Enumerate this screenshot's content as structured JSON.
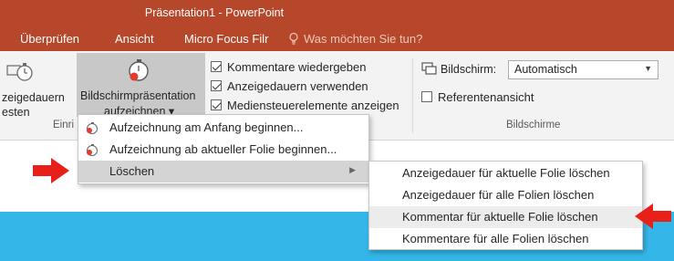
{
  "window": {
    "title": "Präsentation1 - PowerPoint"
  },
  "tabs": [
    "Überprüfen",
    "Ansicht",
    "Micro Focus Filr"
  ],
  "tell_me": {
    "placeholder": "Was möchten Sie tun?",
    "icon": "lightbulb-icon"
  },
  "ribbon": {
    "timings_button_label": [
      "zeigedauern",
      "esten"
    ],
    "record_button_label": [
      "Bildschirmpräsentation",
      "aufzeichnen ▾"
    ],
    "setup_group_label": "Einri",
    "checkboxes": [
      {
        "label": "Kommentare wiedergeben",
        "checked": true
      },
      {
        "label": "Anzeigedauern verwenden",
        "checked": true
      },
      {
        "label": "Mediensteuerelemente anzeigen",
        "checked": true
      }
    ],
    "monitor_label": "Bildschirm:",
    "monitor_value": "Automatisch",
    "presenter_view": {
      "label": "Referentenansicht",
      "checked": false
    },
    "monitors_group_label": "Bildschirme"
  },
  "record_menu": {
    "items": [
      {
        "label": "Aufzeichnung am Anfang beginnen...",
        "icon": "record-from-start-icon"
      },
      {
        "label": "Aufzeichnung ab aktueller Folie beginnen...",
        "icon": "record-from-current-icon"
      },
      {
        "label": "Löschen",
        "has_submenu": true,
        "highlighted": true
      }
    ]
  },
  "clear_submenu": {
    "items": [
      {
        "label": "Anzeigedauer für aktuelle Folie löschen"
      },
      {
        "label": "Anzeigedauer für alle Folien löschen"
      },
      {
        "label": "Kommentar für aktuelle Folie löschen",
        "highlighted": true
      },
      {
        "label": "Kommentare für alle Folien löschen"
      }
    ]
  },
  "colors": {
    "title_bar": "#b7472a",
    "ribbon": "#f3f3f3",
    "slide_strip": "#35b6e8",
    "annotation_arrow": "#e8201a"
  }
}
